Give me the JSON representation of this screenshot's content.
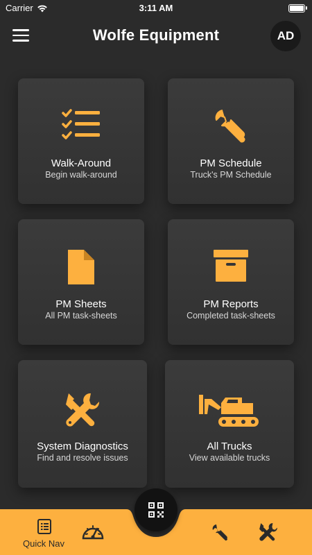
{
  "status_bar": {
    "carrier": "Carrier",
    "time": "3:11 AM",
    "battery_level": 0.9
  },
  "header": {
    "title": "Wolfe Equipment",
    "avatar_initials": "AD"
  },
  "cards": [
    {
      "label": "Walk-Around",
      "subtitle": "Begin walk-around",
      "icon": "checklist-icon"
    },
    {
      "label": "PM Schedule",
      "subtitle": "Truck's PM Schedule",
      "icon": "wrench-icon"
    },
    {
      "label": "PM Sheets",
      "subtitle": "All PM task-sheets",
      "icon": "document-icon"
    },
    {
      "label": "PM Reports",
      "subtitle": "Completed task-sheets",
      "icon": "archive-box-icon"
    },
    {
      "label": "System Diagnostics",
      "subtitle": "Find and resolve issues",
      "icon": "tools-icon"
    },
    {
      "label": "All Trucks",
      "subtitle": "View available trucks",
      "icon": "excavator-icon"
    }
  ],
  "bottom_nav": {
    "quick_nav_label": "Quick Nav",
    "items": [
      "list-icon",
      "speedometer-icon",
      "qr-code-icon",
      "wrench-icon",
      "tools-icon"
    ]
  },
  "colors": {
    "accent": "#FDB03F",
    "background": "#2B2B2B",
    "card": "#363636",
    "fab": "#121212"
  }
}
